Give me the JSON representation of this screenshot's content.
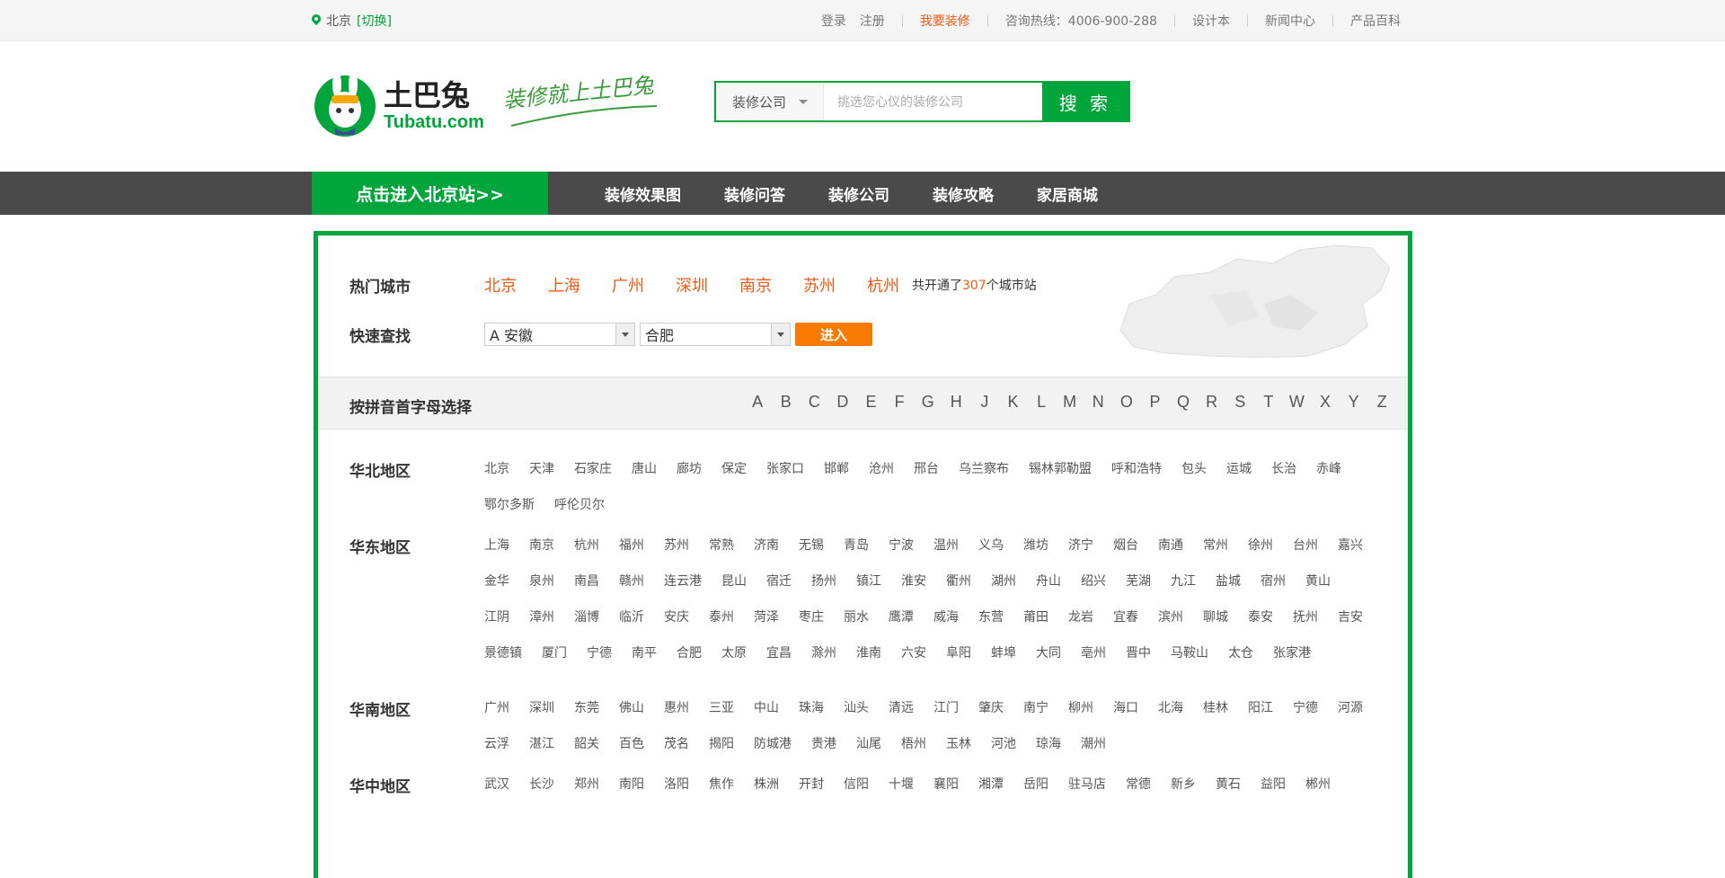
{
  "topbar": {
    "location": "北京",
    "switch_label": "[切换]",
    "links": {
      "login": "登录",
      "register": "注册",
      "want_decorate": "我要装修",
      "hotline": "咨询热线：4006-900-288",
      "design": "设计本",
      "news": "新闻中心",
      "products": "产品百科"
    }
  },
  "header": {
    "logo_name": "土巴兔",
    "logo_domain": "Tubatu.com",
    "slogan": "装修就上土巴兔",
    "search": {
      "type_label": "装修公司",
      "placeholder": "挑选您心仪的装修公司",
      "button": "搜 索"
    }
  },
  "nav": {
    "enter_city": "点击进入北京站>>",
    "items": [
      "装修效果图",
      "装修问答",
      "装修公司",
      "装修攻略",
      "家居商城"
    ]
  },
  "hot": {
    "label": "热门城市",
    "cities": [
      "北京",
      "上海",
      "广州",
      "深圳",
      "南京",
      "苏州",
      "杭州"
    ],
    "note_prefix": "共开通了",
    "note_count": "307",
    "note_suffix": "个城市站"
  },
  "quick": {
    "label": "快速查找",
    "province": "A 安徽",
    "city": "合肥",
    "button": "进入"
  },
  "letters": {
    "label": "按拼音首字母选择",
    "items": [
      "A",
      "B",
      "C",
      "D",
      "E",
      "F",
      "G",
      "H",
      "J",
      "K",
      "L",
      "M",
      "N",
      "O",
      "P",
      "Q",
      "R",
      "S",
      "T",
      "W",
      "X",
      "Y",
      "Z"
    ]
  },
  "regions": [
    {
      "name": "华北地区",
      "cities": [
        "北京",
        "天津",
        "石家庄",
        "唐山",
        "廊坊",
        "保定",
        "张家口",
        "邯郸",
        "沧州",
        "邢台",
        "乌兰察布",
        "锡林郭勒盟",
        "呼和浩特",
        "包头",
        "运城",
        "长治",
        "赤峰",
        "鄂尔多斯",
        "呼伦贝尔"
      ]
    },
    {
      "name": "华东地区",
      "cities": [
        "上海",
        "南京",
        "杭州",
        "福州",
        "苏州",
        "常熟",
        "济南",
        "无锡",
        "青岛",
        "宁波",
        "温州",
        "义乌",
        "潍坊",
        "济宁",
        "烟台",
        "南通",
        "常州",
        "徐州",
        "台州",
        "嘉兴",
        "金华",
        "泉州",
        "南昌",
        "赣州",
        "连云港",
        "昆山",
        "宿迁",
        "扬州",
        "镇江",
        "淮安",
        "衢州",
        "湖州",
        "舟山",
        "绍兴",
        "芜湖",
        "九江",
        "盐城",
        "宿州",
        "黄山",
        "江阴",
        "漳州",
        "淄博",
        "临沂",
        "安庆",
        "泰州",
        "菏泽",
        "枣庄",
        "丽水",
        "鹰潭",
        "威海",
        "东营",
        "莆田",
        "龙岩",
        "宜春",
        "滨州",
        "聊城",
        "泰安",
        "抚州",
        "吉安",
        "景德镇",
        "厦门",
        "宁德",
        "南平",
        "合肥",
        "太原",
        "宜昌",
        "滁州",
        "淮南",
        "六安",
        "阜阳",
        "蚌埠",
        "大同",
        "亳州",
        "晋中",
        "马鞍山",
        "太仓",
        "张家港"
      ]
    },
    {
      "name": "华南地区",
      "cities": [
        "广州",
        "深圳",
        "东莞",
        "佛山",
        "惠州",
        "三亚",
        "中山",
        "珠海",
        "汕头",
        "清远",
        "江门",
        "肇庆",
        "南宁",
        "柳州",
        "海口",
        "北海",
        "桂林",
        "阳江",
        "宁德",
        "河源",
        "云浮",
        "湛江",
        "韶关",
        "百色",
        "茂名",
        "揭阳",
        "防城港",
        "贵港",
        "汕尾",
        "梧州",
        "玉林",
        "河池",
        "琼海",
        "潮州"
      ]
    },
    {
      "name": "华中地区",
      "cities": [
        "武汉",
        "长沙",
        "郑州",
        "南阳",
        "洛阳",
        "焦作",
        "株洲",
        "开封",
        "信阳",
        "十堰",
        "襄阳",
        "湘潭",
        "岳阳",
        "驻马店",
        "常德",
        "新乡",
        "黄石",
        "益阳",
        "郴州"
      ]
    }
  ]
}
